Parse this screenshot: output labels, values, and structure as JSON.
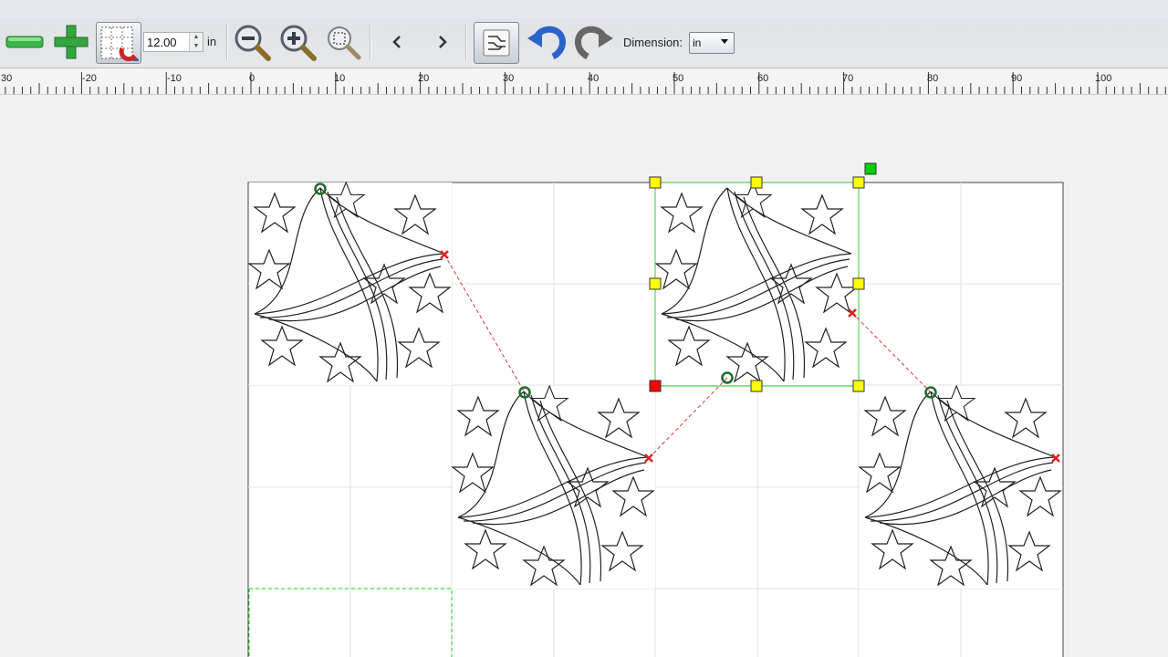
{
  "toolbar": {
    "grid_size_value": "12.00",
    "grid_unit": "in",
    "dimension_label": "Dimension:",
    "dimension_value": "in"
  },
  "ruler": {
    "labels": [
      "30",
      "-20",
      "-10",
      "0",
      "10",
      "20",
      "30",
      "40",
      "50",
      "60",
      "70",
      "80",
      "90",
      "100"
    ]
  },
  "colors": {
    "handle_yellow": "#ffff00",
    "handle_red": "#ff0000",
    "handle_green": "#00d000",
    "selection_green": "#33cc33",
    "end_marker_red": "#e02020",
    "start_marker_green": "#1e6b2e",
    "connector_red": "#d43a3a"
  },
  "icons": [
    "minus-icon",
    "plus-icon",
    "magnet-grid-icon",
    "zoom-out-icon",
    "zoom-in-icon",
    "zoom-fit-icon",
    "previous-icon",
    "next-icon",
    "path-toggle-icon",
    "undo-icon",
    "redo-icon"
  ]
}
